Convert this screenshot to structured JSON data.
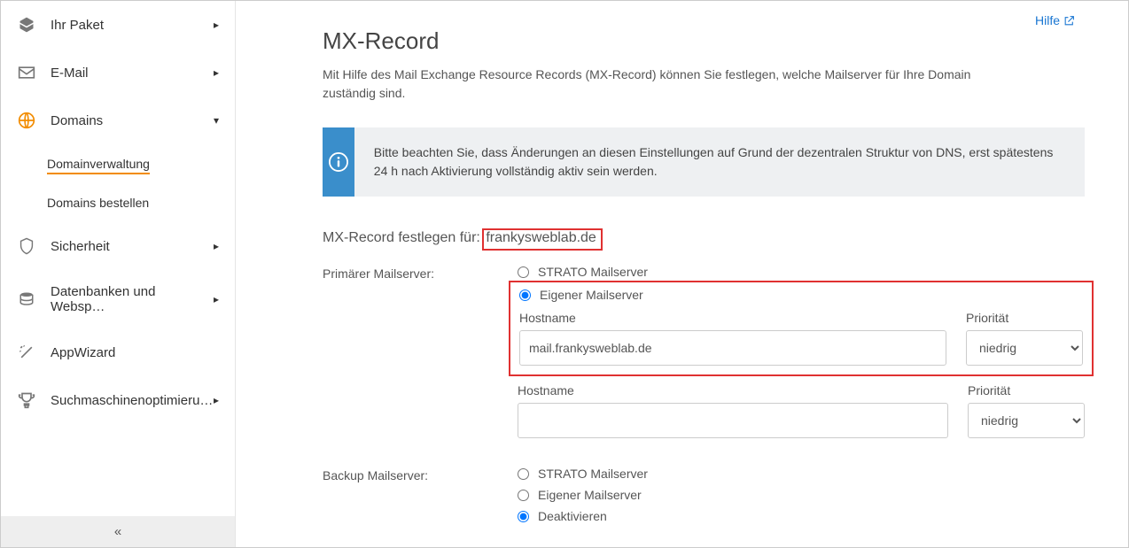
{
  "sidebar": {
    "items": [
      {
        "label": "Ihr Paket",
        "expanded": false
      },
      {
        "label": "E-Mail",
        "expanded": false
      },
      {
        "label": "Domains",
        "expanded": true
      },
      {
        "label": "Sicherheit",
        "expanded": false
      },
      {
        "label": "Datenbanken und Websp…",
        "expanded": false
      },
      {
        "label": "AppWizard",
        "expanded": false
      },
      {
        "label": "Suchmaschinenoptimieru…",
        "expanded": false
      }
    ],
    "sub_items": [
      {
        "label": "Domainverwaltung",
        "active": true
      },
      {
        "label": "Domains bestellen",
        "active": false
      }
    ]
  },
  "header": {
    "help": "Hilfe"
  },
  "page": {
    "title": "MX-Record",
    "intro": "Mit Hilfe des Mail Exchange Resource Records (MX-Record) können Sie festlegen, welche Mailserver für Ihre Domain zuständig sind.",
    "info": "Bitte beachten Sie, dass Änderungen an diesen Einstellungen auf Grund der dezentralen Struktur von DNS, erst spätestens 24 h nach Aktivierung vollständig aktiv sein werden.",
    "set_for_prefix": "MX-Record festlegen für:",
    "domain": "frankysweblab.de"
  },
  "form": {
    "primary_label": "Primärer Mailserver:",
    "backup_label": "Backup Mailserver:",
    "option_strato": "STRATO Mailserver",
    "option_own": "Eigener Mailserver",
    "option_disable": "Deaktivieren",
    "hostname_label": "Hostname",
    "priority_label": "Priorität",
    "priority_value": "niedrig",
    "rows": [
      {
        "hostname": "mail.frankysweblab.de",
        "priority": "niedrig"
      },
      {
        "hostname": "",
        "priority": "niedrig"
      }
    ],
    "primary_selected": "own",
    "backup_selected": "disable"
  }
}
